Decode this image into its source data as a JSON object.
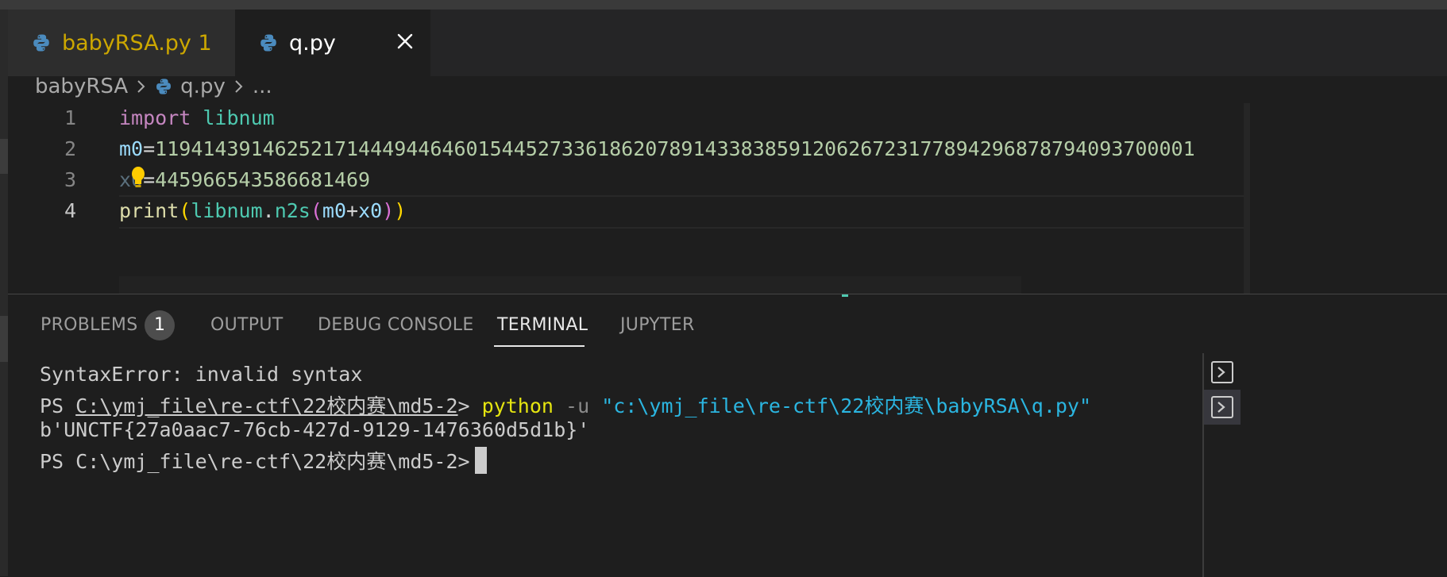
{
  "tabs": [
    {
      "label": "babyRSA.py 1"
    },
    {
      "label": "q.py"
    }
  ],
  "breadcrumb": {
    "folder": "babyRSA",
    "file": "q.py",
    "more": "..."
  },
  "editor": {
    "line_numbers": [
      "1",
      "2",
      "3",
      "4"
    ],
    "line1": {
      "kw": "import",
      "mod": "libnum"
    },
    "line2": {
      "var": "m0",
      "eq": "=",
      "num": "119414391462521714449446460154452733618620789143383859120626723177894296878794093700001"
    },
    "line3": {
      "var": "x0",
      "eq": "=",
      "num": "445966543586681469"
    },
    "line4": {
      "fn": "print",
      "lp": "(",
      "mod": "libnum",
      "dot": ".",
      "fn2": "n2s",
      "lp2": "(",
      "a": "m0",
      "plus": "+",
      "b": "x0",
      "rp2": ")",
      "rp": ")"
    }
  },
  "panel": {
    "tabs": {
      "problems": "PROBLEMS",
      "output": "OUTPUT",
      "debug": "DEBUG CONSOLE",
      "terminal": "TERMINAL",
      "jupyter": "JUPYTER"
    },
    "problems_count": "1"
  },
  "terminal": {
    "line1": "SyntaxError: invalid syntax",
    "line2_ps": "PS ",
    "line2_path": "C:\\ymj_file\\re-ctf\\22校内赛\\md5-2",
    "line2_gt": "> ",
    "line2_cmd": "python",
    "line2_flag": " -u ",
    "line2_arg": "\"c:\\ymj_file\\re-ctf\\22校内赛\\babyRSA\\q.py\"",
    "line3": "b'UNCTF{27a0aac7-76cb-427d-9129-1476360d5d1b}'",
    "line4": "PS C:\\ymj_file\\re-ctf\\22校内赛\\md5-2>"
  },
  "colors": {
    "accent": "#4ec9b0",
    "warning": "#cca700"
  }
}
